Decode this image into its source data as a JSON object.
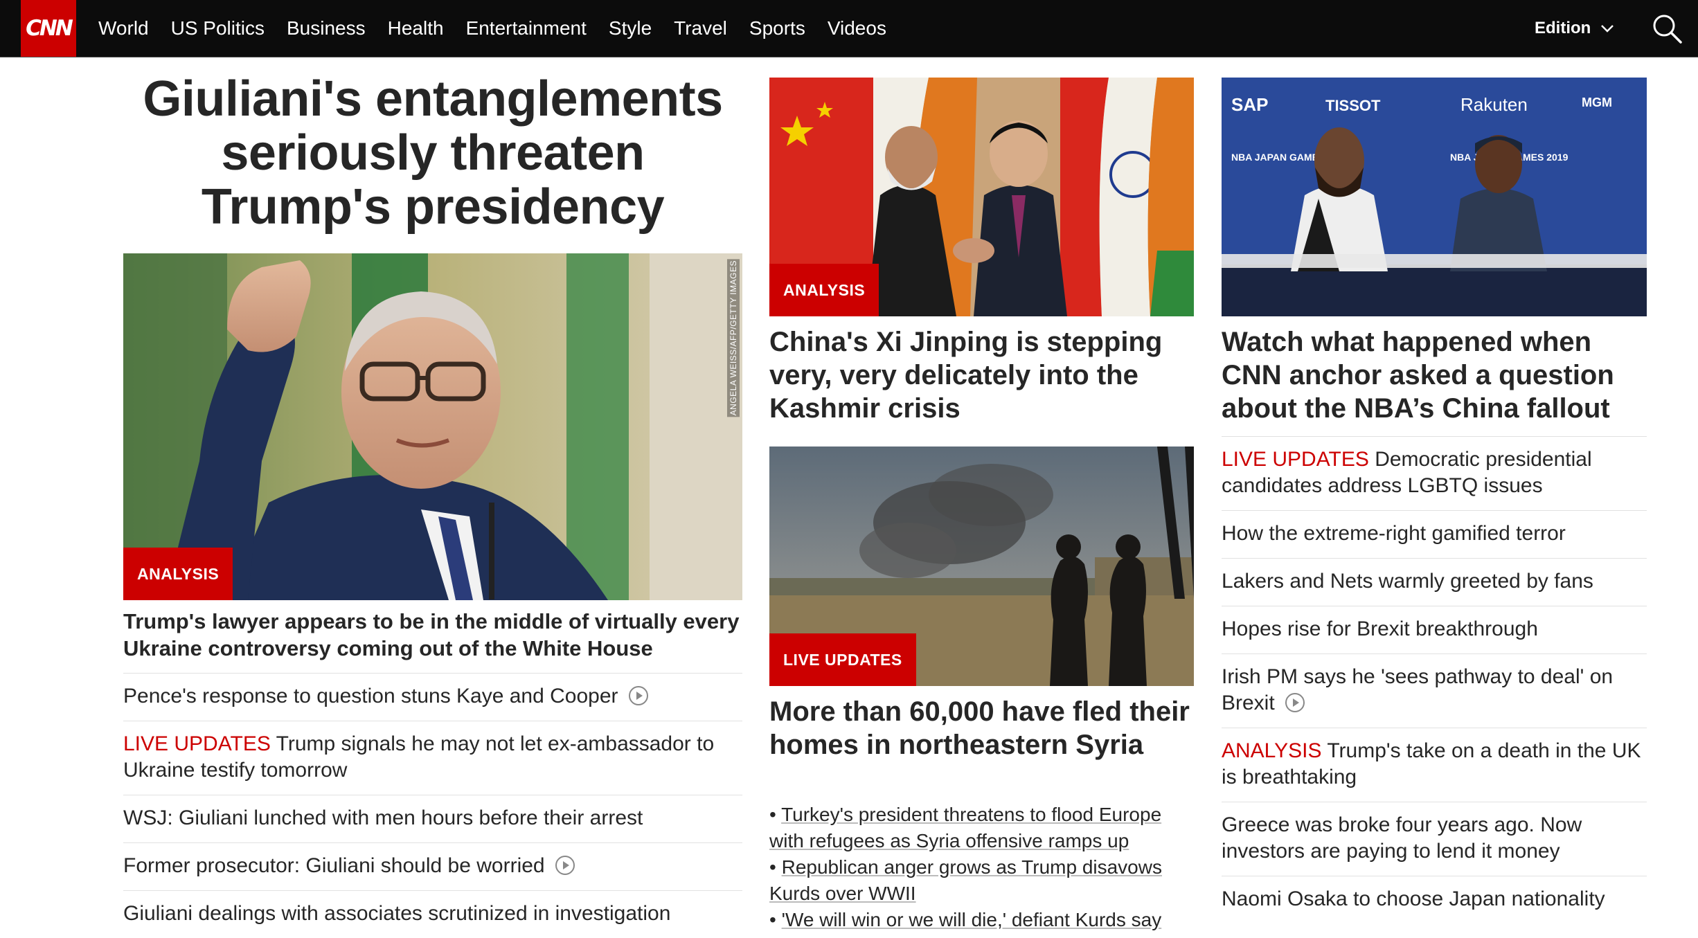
{
  "nav": {
    "logo": "CNN",
    "items": [
      "World",
      "US Politics",
      "Business",
      "Health",
      "Entertainment",
      "Style",
      "Travel",
      "Sports",
      "Videos"
    ],
    "edition_label": "Edition"
  },
  "col1": {
    "headline": "Giuliani's entanglements seriously threaten Trump's presidency",
    "image_badge": "ANALYSIS",
    "image_credit": "ANGELA WEISS/AFP/GETTY IMAGES",
    "sub_headline": "Trump's lawyer appears to be in the middle of virtually every Ukraine controversy coming out of the White House",
    "stories": [
      {
        "label": "",
        "text": "Pence's response to question stuns Kaye and Cooper",
        "video": true
      },
      {
        "label": "LIVE UPDATES",
        "text": "Trump signals he may not let ex-ambassador to Ukraine testify tomorrow",
        "video": false
      },
      {
        "label": "",
        "text": "WSJ: Giuliani lunched with men hours before their arrest",
        "video": false
      },
      {
        "label": "",
        "text": "Former prosecutor: Giuliani should be worried",
        "video": true
      },
      {
        "label": "",
        "text": "Giuliani dealings with associates scrutinized in investigation",
        "video": false
      }
    ]
  },
  "col2": {
    "card1": {
      "badge": "ANALYSIS",
      "title": "China's Xi Jinping is stepping very, very delicately into the Kashmir crisis"
    },
    "card2": {
      "badge": "LIVE UPDATES",
      "title": "More than 60,000 have fled their homes in northeastern Syria",
      "bullets": [
        "Turkey's president threatens to flood Europe with refugees as Syria offensive ramps up",
        "Republican anger grows as Trump disavows Kurds over WWII",
        "'We will win or we will die,' defiant Kurds say"
      ]
    }
  },
  "col3": {
    "card1": {
      "title": "Watch what happened when CNN anchor asked a question about the NBA’s China fallout",
      "sponsors": [
        "SAP",
        "TISSOT",
        "Rakuten",
        "MGM",
        "NBA JAPAN GAMES 2019"
      ]
    },
    "stories": [
      {
        "label": "LIVE UPDATES",
        "text": "Democratic presidential candidates address LGBTQ issues",
        "video": false
      },
      {
        "label": "",
        "text": "How the extreme-right gamified terror",
        "video": false
      },
      {
        "label": "",
        "text": "Lakers and Nets warmly greeted by fans",
        "video": false
      },
      {
        "label": "",
        "text": "Hopes rise for Brexit breakthrough",
        "video": false
      },
      {
        "label": "",
        "text": "Irish PM says he 'sees pathway to deal' on Brexit",
        "video": true
      },
      {
        "label": "ANALYSIS",
        "text": "Trump's take on a death in the UK is breathtaking",
        "video": false
      },
      {
        "label": "",
        "text": "Greece was broke four years ago. Now investors are paying to lend it money",
        "video": false
      },
      {
        "label": "",
        "text": "Naomi Osaka to choose Japan nationality",
        "video": false
      }
    ]
  },
  "colors": {
    "brand_red": "#cc0000",
    "nav_bg": "#0c0c0c",
    "text": "#262626",
    "divider": "#e1e1e1"
  }
}
